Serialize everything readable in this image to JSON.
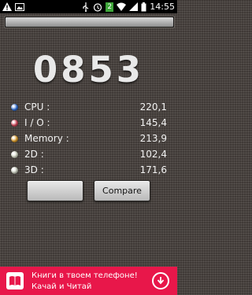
{
  "status_bar": {
    "time": "14:55",
    "notification_count": "2",
    "icons": [
      "warning-icon",
      "image-icon",
      "usb-icon",
      "alarm-icon",
      "notification-badge-icon",
      "wifi-icon",
      "signal-icon",
      "battery-icon"
    ]
  },
  "progress": {
    "fraction": 1.0
  },
  "score": "0853",
  "metrics": [
    {
      "label": "CPU :",
      "value": "220,1",
      "color": "#2f6fd8"
    },
    {
      "label": "I / O :",
      "value": "145,4",
      "color": "#d9475a"
    },
    {
      "label": "Memory :",
      "value": "213,9",
      "color": "#e2a02a"
    },
    {
      "label": "2D :",
      "value": "102,4",
      "color": "#d8dcc9"
    },
    {
      "label": "3D :",
      "value": "171,6",
      "color": "#d3d7c8"
    }
  ],
  "buttons": {
    "left_label": "",
    "compare_label": "Compare"
  },
  "ad": {
    "line1": "Книги в твоем телефоне!",
    "line2": "Качай и Читай",
    "background": "#e8174a"
  }
}
